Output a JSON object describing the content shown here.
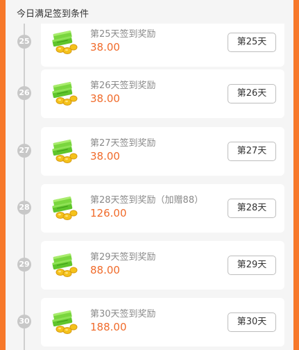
{
  "header": {
    "title": "今日满足签到条件"
  },
  "rows": [
    {
      "day": "25",
      "title": "第25天签到奖励",
      "amount": "38.00",
      "button_label": "第25天"
    },
    {
      "day": "26",
      "title": "第26天签到奖励",
      "amount": "38.00",
      "button_label": "第26天"
    },
    {
      "day": "27",
      "title": "第27天签到奖励",
      "amount": "38.00",
      "button_label": "第27天"
    },
    {
      "day": "28",
      "title": "第28天签到奖励（加赠88）",
      "amount": "126.00",
      "button_label": "第28天"
    },
    {
      "day": "29",
      "title": "第29天签到奖励",
      "amount": "88.00",
      "button_label": "第29天"
    },
    {
      "day": "30",
      "title": "第30天签到奖励",
      "amount": "188.00",
      "button_label": "第30天"
    }
  ],
  "colors": {
    "page_background": "#f7782a",
    "panel_background": "#f5f5f5",
    "amount_text": "#f06b2b",
    "badge": "#c8c8c8",
    "money_green": "#5fc52b",
    "coin_gold": "#f5c21b"
  },
  "icons": {
    "reward": "money-stack-icon"
  }
}
